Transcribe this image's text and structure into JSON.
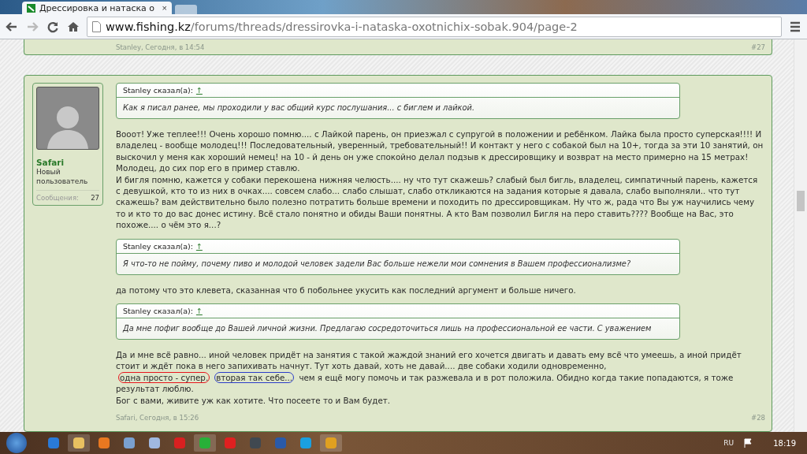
{
  "browser": {
    "tab_title": "Дрессировка и натаска о",
    "tab_close": "×",
    "url_host": "www.fishing.kz",
    "url_path": "/forums/threads/dressirovka-i-nataska-oxotnichix-sobak.904/page-2"
  },
  "posts": [
    {
      "kind": "tail",
      "footer": "Stanley, Сегодня, в 14:54",
      "number": "#27"
    },
    {
      "kind": "full",
      "user": {
        "name": "Safari",
        "title": "Новый пользователь",
        "stat_label": "Сообщения:",
        "stat_value": "27"
      },
      "blocks": [
        {
          "kind": "quote",
          "author": "Stanley сказал(а):",
          "link": "↑",
          "text": "Как я писал ранее, мы проходили у вас общий курс послушания... с биглем и лайкой."
        },
        {
          "kind": "text",
          "lines": [
            {
              "segments": [
                {
                  "text": "Вооот! Уже теплее!!! Очень хорошо помню.... с Лайкой парень, он приезжал с супругой в положении и ребёнком. Лайка была просто суперская!!!! И владелец - вообще молодец!!! Последовательный, уверенный, требовательный!! И контакт у него с собакой был на 10+, тогда за эти 10 занятий, он выскочил у меня как хороший немец! на 10 - й день он уже спокойно делал подзыв к дрессировщику и возврат на место примерно на 15 метрах! Молодец, до сих пор его в пример ставлю."
                }
              ]
            },
            {
              "segments": [
                {
                  "text": "И бигля помню, кажется у собаки перекошена нижняя челюсть.... ну что тут скажешь? слабый был бигль, владелец, симпатичный парень, кажется с девушкой, кто то из них в очках.... совсем слабо... слабо слышат, слабо откликаются на задания которые я давала, слабо выполняли.. что тут скажешь? вам действительно было полезно потратить больше времени и походить по дрессировщикам. Ну что ж, рада что Вы уж научились чему то и кто то до вас донес истину. Всё стало понятно и обиды Ваши понятны. А кто Вам позволил Бигля на перо ставить???? Вообще на Вас, это похоже.... о чём это я...?"
                }
              ]
            }
          ]
        },
        {
          "kind": "quote",
          "author": "Stanley сказал(а):",
          "link": "↑",
          "text": "Я что-то не пойму, почему пиво и молодой человек задели Вас больше нежели мои сомнения в Вашем профессионализме?"
        },
        {
          "kind": "text",
          "lines": [
            {
              "segments": [
                {
                  "text": "да потому что это клевета, сказанная что б побольнее укусить как последний аргумент и больше ничего."
                }
              ]
            }
          ]
        },
        {
          "kind": "quote",
          "author": "Stanley сказал(а):",
          "link": "↑",
          "text": "Да мне пофиг вообще до Вашей личной жизни. Предлагаю сосредоточиться лишь на профессиональной ее части. С уважением"
        },
        {
          "kind": "text",
          "lines": [
            {
              "segments": [
                {
                  "text": "Да и мне всё равно... иной человек придёт на занятия с такой жаждой знаний его хочется двигать и давать ему всё что умеешь, а иной придёт стоит и ждёт пока в него запихивать начнут. Тут хоть давай, хоть не давай.... две собаки ходили одновременно, "
                },
                {
                  "text": "одна просто - супер.",
                  "color": "#e8141c"
                },
                {
                  "text": "вторая так себе...",
                  "color": "#2b3cc8"
                },
                {
                  "text": " чем я ещё могу помочь и так разжевала и в рот положила. Обидно когда такие попадаются, я тоже результат люблю."
                }
              ]
            },
            {
              "segments": [
                {
                  "text": "Бог с вами, живите уж как хотите. Что посеете то и Вам будет."
                }
              ]
            }
          ]
        }
      ],
      "footer": "Safari, Сегодня, в 15:26",
      "number": "#28"
    }
  ],
  "taskbar": {
    "language": "RU",
    "time": "18:19"
  }
}
